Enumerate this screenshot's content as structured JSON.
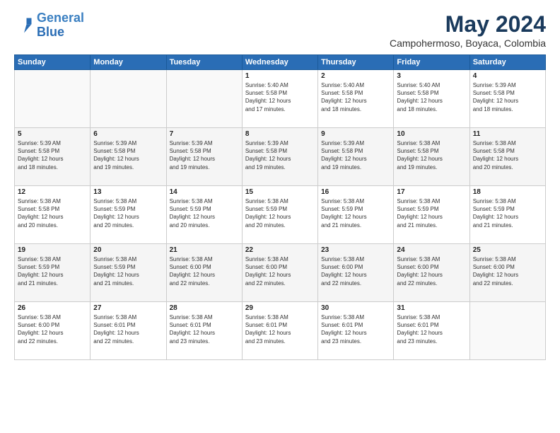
{
  "header": {
    "logo_line1": "General",
    "logo_line2": "Blue",
    "month": "May 2024",
    "location": "Campohermoso, Boyaca, Colombia"
  },
  "days_of_week": [
    "Sunday",
    "Monday",
    "Tuesday",
    "Wednesday",
    "Thursday",
    "Friday",
    "Saturday"
  ],
  "weeks": [
    [
      {
        "day": "",
        "info": ""
      },
      {
        "day": "",
        "info": ""
      },
      {
        "day": "",
        "info": ""
      },
      {
        "day": "1",
        "info": "Sunrise: 5:40 AM\nSunset: 5:58 PM\nDaylight: 12 hours\nand 17 minutes."
      },
      {
        "day": "2",
        "info": "Sunrise: 5:40 AM\nSunset: 5:58 PM\nDaylight: 12 hours\nand 18 minutes."
      },
      {
        "day": "3",
        "info": "Sunrise: 5:40 AM\nSunset: 5:58 PM\nDaylight: 12 hours\nand 18 minutes."
      },
      {
        "day": "4",
        "info": "Sunrise: 5:39 AM\nSunset: 5:58 PM\nDaylight: 12 hours\nand 18 minutes."
      }
    ],
    [
      {
        "day": "5",
        "info": "Sunrise: 5:39 AM\nSunset: 5:58 PM\nDaylight: 12 hours\nand 18 minutes."
      },
      {
        "day": "6",
        "info": "Sunrise: 5:39 AM\nSunset: 5:58 PM\nDaylight: 12 hours\nand 19 minutes."
      },
      {
        "day": "7",
        "info": "Sunrise: 5:39 AM\nSunset: 5:58 PM\nDaylight: 12 hours\nand 19 minutes."
      },
      {
        "day": "8",
        "info": "Sunrise: 5:39 AM\nSunset: 5:58 PM\nDaylight: 12 hours\nand 19 minutes."
      },
      {
        "day": "9",
        "info": "Sunrise: 5:39 AM\nSunset: 5:58 PM\nDaylight: 12 hours\nand 19 minutes."
      },
      {
        "day": "10",
        "info": "Sunrise: 5:38 AM\nSunset: 5:58 PM\nDaylight: 12 hours\nand 19 minutes."
      },
      {
        "day": "11",
        "info": "Sunrise: 5:38 AM\nSunset: 5:58 PM\nDaylight: 12 hours\nand 20 minutes."
      }
    ],
    [
      {
        "day": "12",
        "info": "Sunrise: 5:38 AM\nSunset: 5:58 PM\nDaylight: 12 hours\nand 20 minutes."
      },
      {
        "day": "13",
        "info": "Sunrise: 5:38 AM\nSunset: 5:59 PM\nDaylight: 12 hours\nand 20 minutes."
      },
      {
        "day": "14",
        "info": "Sunrise: 5:38 AM\nSunset: 5:59 PM\nDaylight: 12 hours\nand 20 minutes."
      },
      {
        "day": "15",
        "info": "Sunrise: 5:38 AM\nSunset: 5:59 PM\nDaylight: 12 hours\nand 20 minutes."
      },
      {
        "day": "16",
        "info": "Sunrise: 5:38 AM\nSunset: 5:59 PM\nDaylight: 12 hours\nand 21 minutes."
      },
      {
        "day": "17",
        "info": "Sunrise: 5:38 AM\nSunset: 5:59 PM\nDaylight: 12 hours\nand 21 minutes."
      },
      {
        "day": "18",
        "info": "Sunrise: 5:38 AM\nSunset: 5:59 PM\nDaylight: 12 hours\nand 21 minutes."
      }
    ],
    [
      {
        "day": "19",
        "info": "Sunrise: 5:38 AM\nSunset: 5:59 PM\nDaylight: 12 hours\nand 21 minutes."
      },
      {
        "day": "20",
        "info": "Sunrise: 5:38 AM\nSunset: 5:59 PM\nDaylight: 12 hours\nand 21 minutes."
      },
      {
        "day": "21",
        "info": "Sunrise: 5:38 AM\nSunset: 6:00 PM\nDaylight: 12 hours\nand 22 minutes."
      },
      {
        "day": "22",
        "info": "Sunrise: 5:38 AM\nSunset: 6:00 PM\nDaylight: 12 hours\nand 22 minutes."
      },
      {
        "day": "23",
        "info": "Sunrise: 5:38 AM\nSunset: 6:00 PM\nDaylight: 12 hours\nand 22 minutes."
      },
      {
        "day": "24",
        "info": "Sunrise: 5:38 AM\nSunset: 6:00 PM\nDaylight: 12 hours\nand 22 minutes."
      },
      {
        "day": "25",
        "info": "Sunrise: 5:38 AM\nSunset: 6:00 PM\nDaylight: 12 hours\nand 22 minutes."
      }
    ],
    [
      {
        "day": "26",
        "info": "Sunrise: 5:38 AM\nSunset: 6:00 PM\nDaylight: 12 hours\nand 22 minutes."
      },
      {
        "day": "27",
        "info": "Sunrise: 5:38 AM\nSunset: 6:01 PM\nDaylight: 12 hours\nand 22 minutes."
      },
      {
        "day": "28",
        "info": "Sunrise: 5:38 AM\nSunset: 6:01 PM\nDaylight: 12 hours\nand 23 minutes."
      },
      {
        "day": "29",
        "info": "Sunrise: 5:38 AM\nSunset: 6:01 PM\nDaylight: 12 hours\nand 23 minutes."
      },
      {
        "day": "30",
        "info": "Sunrise: 5:38 AM\nSunset: 6:01 PM\nDaylight: 12 hours\nand 23 minutes."
      },
      {
        "day": "31",
        "info": "Sunrise: 5:38 AM\nSunset: 6:01 PM\nDaylight: 12 hours\nand 23 minutes."
      },
      {
        "day": "",
        "info": ""
      }
    ]
  ]
}
